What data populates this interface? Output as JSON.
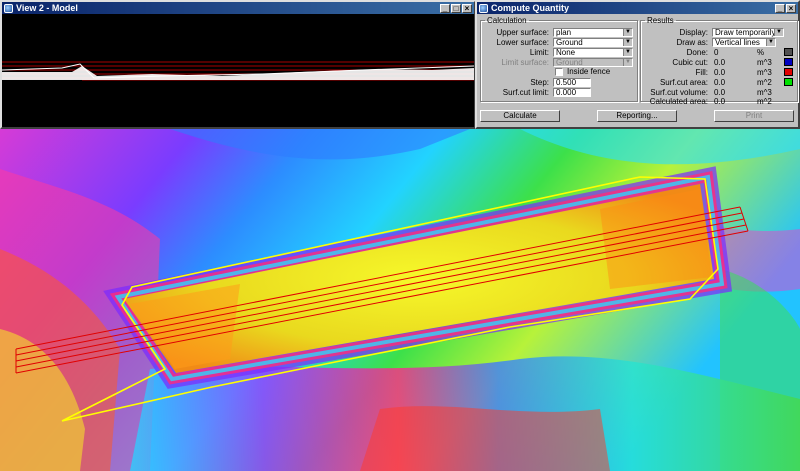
{
  "view2": {
    "title": "View 2 - Model"
  },
  "dialog": {
    "title": "Compute Quantity",
    "calculation": {
      "legend": "Calculation",
      "upper_surface_label": "Upper surface:",
      "upper_surface_value": "plan",
      "lower_surface_label": "Lower surface:",
      "lower_surface_value": "Ground",
      "limit_label": "Limit:",
      "limit_value": "None",
      "limit_surface_label": "Limit surface:",
      "limit_surface_value": "Ground",
      "inside_fence_label": "Inside fence",
      "inside_fence_checked": false,
      "step_label": "Step:",
      "step_value": "0.500",
      "surf_cut_limit_label": "Surf.cut limit:",
      "surf_cut_limit_value": "0.000"
    },
    "results": {
      "legend": "Results",
      "display_label": "Display:",
      "display_value": "Draw temporarily",
      "draw_as_label": "Draw as:",
      "draw_as_value": "Vertical lines",
      "rows": [
        {
          "label": "Done:",
          "value": "0",
          "unit": "%",
          "color": "#505050"
        },
        {
          "label": "Cubic cut:",
          "value": "0.0",
          "unit": "m^3",
          "color": "#0000c0"
        },
        {
          "label": "Fill:",
          "value": "0.0",
          "unit": "m^3",
          "color": "#e00000"
        },
        {
          "label": "Surf.cut area:",
          "value": "0.0",
          "unit": "m^2",
          "color": "#00e000"
        },
        {
          "label": "Surf.cut volume:",
          "value": "0.0",
          "unit": "m^3",
          "color": ""
        },
        {
          "label": "Calculated area:",
          "value": "0.0",
          "unit": "m^2",
          "color": ""
        }
      ]
    },
    "buttons": {
      "calculate": "Calculate",
      "reporting": "Reporting...",
      "print": "Print"
    }
  },
  "titlebar_buttons": {
    "minimize": "_",
    "maximize": "□",
    "close": "×"
  }
}
